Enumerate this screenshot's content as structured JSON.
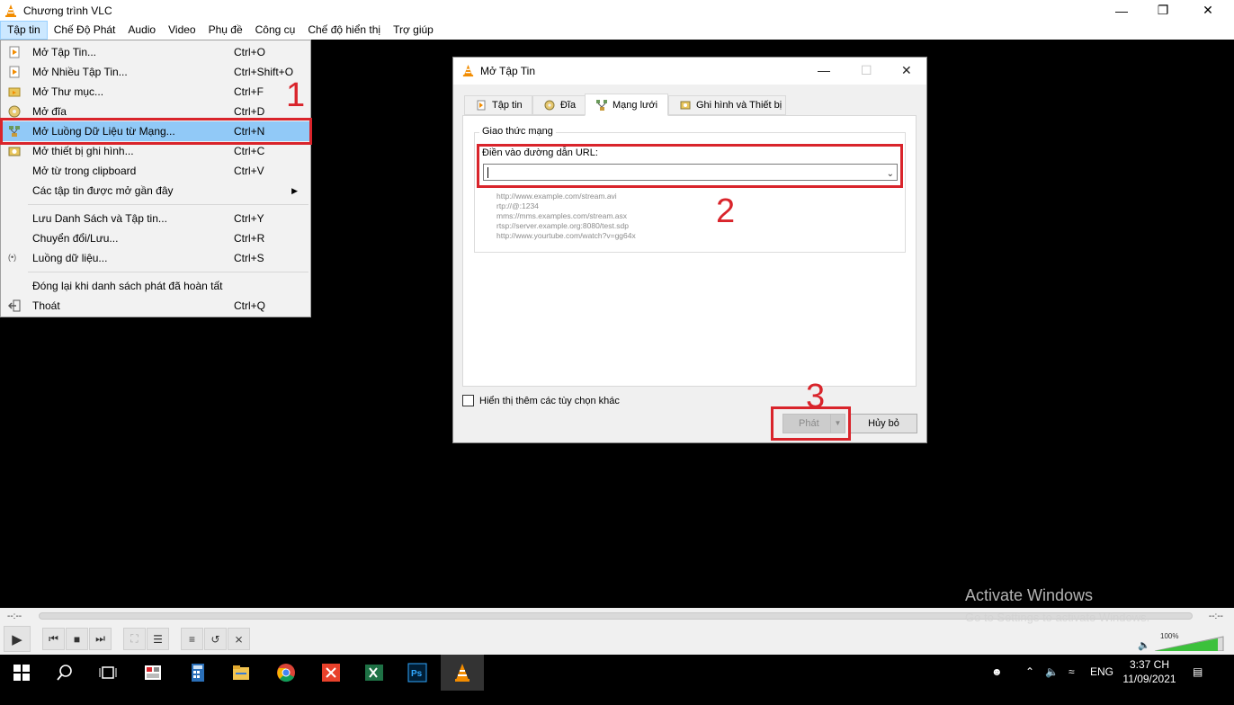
{
  "window": {
    "title": "Chương trình VLC",
    "min": "—",
    "max": "❐",
    "close": "✕"
  },
  "menubar": [
    "Tập tin",
    "Chế Độ Phát",
    "Audio",
    "Video",
    "Phụ đề",
    "Công cụ",
    "Chế độ hiển thị",
    "Trợ giúp"
  ],
  "file_menu": {
    "items": [
      {
        "label": "Mở Tập Tin...",
        "shortcut": "Ctrl+O",
        "icon": "file-play-icon"
      },
      {
        "label": "Mở Nhiều Tập Tin...",
        "shortcut": "Ctrl+Shift+O",
        "icon": "file-play-icon"
      },
      {
        "label": "Mở Thư mục...",
        "shortcut": "Ctrl+F",
        "icon": "folder-icon"
      },
      {
        "label": "Mở đĩa",
        "shortcut": "Ctrl+D",
        "icon": "disc-icon"
      },
      {
        "label": "Mở Luồng Dữ Liệu từ Mạng...",
        "shortcut": "Ctrl+N",
        "icon": "network-icon"
      },
      {
        "label": "Mở thiết bị ghi hình...",
        "shortcut": "Ctrl+C",
        "icon": "capture-device-icon"
      },
      {
        "label": "Mở từ trong clipboard",
        "shortcut": "Ctrl+V",
        "icon": ""
      },
      {
        "label": "Các tập tin được mở gần đây",
        "shortcut": "",
        "icon": ""
      },
      {
        "label": "Lưu Danh Sách và Tập tin...",
        "shortcut": "Ctrl+Y",
        "icon": ""
      },
      {
        "label": "Chuyển đổi/Lưu...",
        "shortcut": "Ctrl+R",
        "icon": ""
      },
      {
        "label": "Luồng dữ liệu...",
        "shortcut": "Ctrl+S",
        "icon": "stream-icon"
      },
      {
        "label": "Đóng lại khi danh sách phát đã hoàn tất",
        "shortcut": "",
        "icon": ""
      },
      {
        "label": "Thoát",
        "shortcut": "Ctrl+Q",
        "icon": "exit-icon"
      }
    ],
    "submenu_arrow": "▶"
  },
  "annotations": {
    "n1": "1",
    "n2": "2",
    "n3": "3"
  },
  "dialog": {
    "title": "Mở Tập Tin",
    "tabs": [
      "Tập tin",
      "Đĩa",
      "Mạng lưới",
      "Ghi hình và Thiết bị"
    ],
    "active_tab": "Mạng lưới",
    "group_title": "Giao thức mạng",
    "url_label": "Điền vào đường dẫn URL:",
    "url_value": "",
    "examples": [
      "http://www.example.com/stream.avi",
      "rtp://@:1234",
      "mms://mms.examples.com/stream.asx",
      "rtsp://server.example.org:8080/test.sdp",
      "http://www.yourtube.com/watch?v=gg64x"
    ],
    "more_options": "Hiển thị thêm các tùy chọn khác",
    "play_button": "Phát",
    "cancel_button": "Hủy bỏ"
  },
  "controls": {
    "time_left": "--:--",
    "time_right": "--:--",
    "volume": "100%"
  },
  "watermark": {
    "line1": "Activate Windows",
    "line2": "Go to Settings to activate Windows."
  },
  "taskbar": {
    "apps": [
      "windows-start-icon",
      "search-icon",
      "task-view-icon",
      "app-icon",
      "calculator-icon",
      "file-explorer-icon",
      "chrome-icon",
      "xmind-icon",
      "excel-icon",
      "photoshop-icon",
      "vlc-icon"
    ],
    "language": "ENG",
    "time": "3:37 CH",
    "date": "11/09/2021"
  },
  "colors": {
    "highlight": "#91c9f7",
    "annotation_red": "#d9242b",
    "vlc_orange": "#f28c00"
  }
}
